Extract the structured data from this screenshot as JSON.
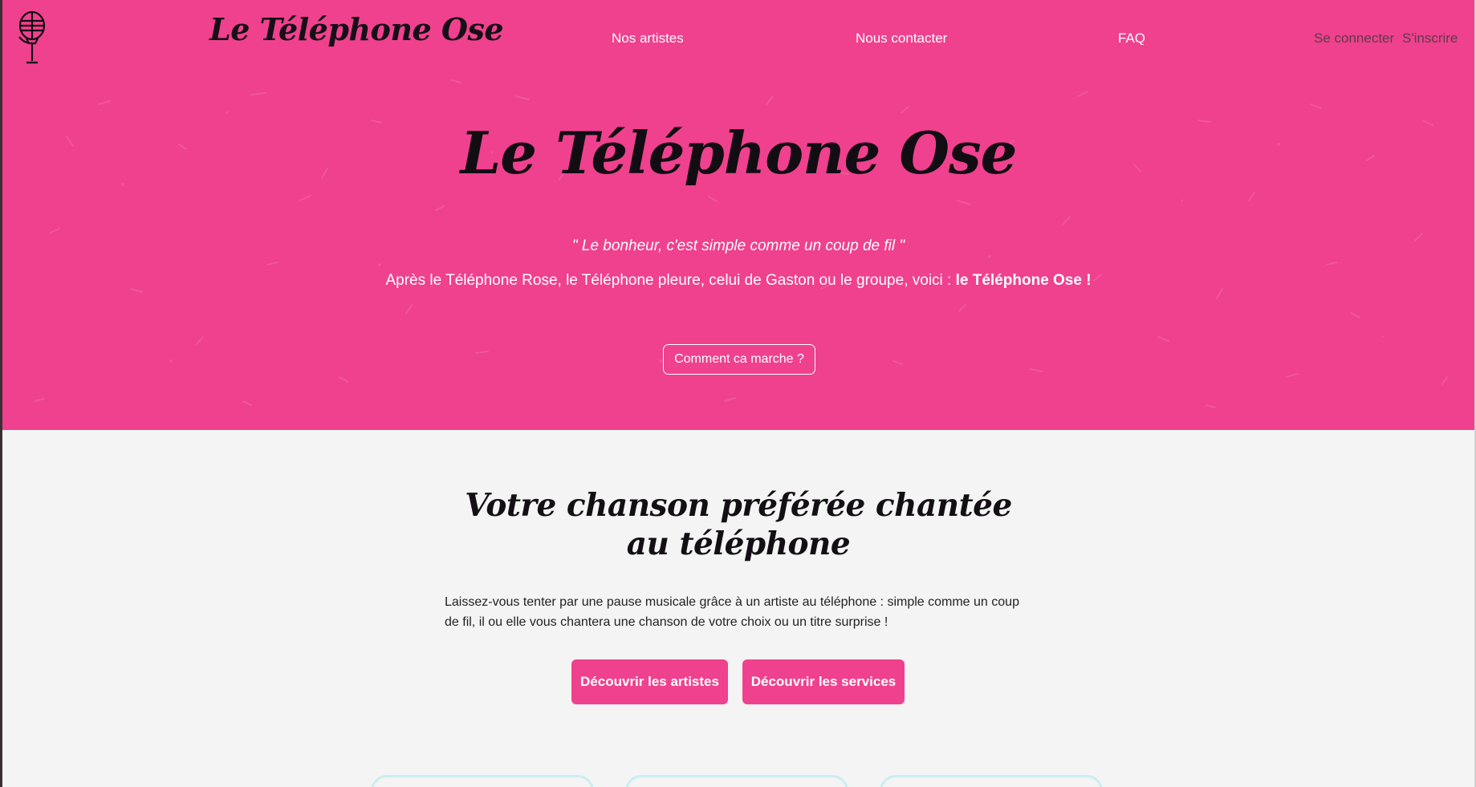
{
  "navbar": {
    "brand": "Le Téléphone Ose",
    "links": [
      "Nos artistes",
      "Nous contacter",
      "FAQ"
    ],
    "auth": {
      "login": "Se connecter",
      "register": "S'inscrire"
    },
    "logo_icon": "microphone-icon"
  },
  "hero": {
    "title": "Le Téléphone Ose",
    "quote": "\" Le bonheur, c'est simple comme un coup de fil \"",
    "intro_text": "Après le Téléphone Rose, le Téléphone pleure, celui de Gaston ou le groupe, voici : ",
    "intro_highlight": "le Téléphone Ose !",
    "cta": "Comment ca marche ?"
  },
  "section": {
    "title": "Votre chanson préférée chantée au téléphone",
    "text": "Laissez-vous tenter par une pause musicale grâce à un artiste au téléphone : simple comme un coup de fil, il ou elle vous chantera une chanson de votre choix ou un titre surprise !",
    "buttons": {
      "artists": "Découvrir les artistes",
      "services": "Découvrir les services"
    }
  },
  "colors": {
    "brand_pink": "#ef418e",
    "background": "#f4f4f4",
    "card_border": "#c9eef0",
    "title_dark": "#120d12"
  }
}
